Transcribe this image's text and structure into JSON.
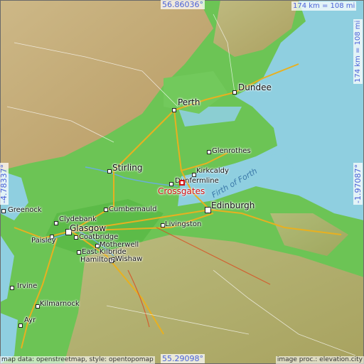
{
  "coords": {
    "north": "56.86036°",
    "south": "55.29098°",
    "west": "-4.78337°",
    "east": "-1.97087°",
    "scale_h": "174 km = 108 mi",
    "scale_v": "174 km = 108 mi"
  },
  "featured": {
    "name": "Crossgates"
  },
  "places": {
    "perth": "Perth",
    "dundee": "Dundee",
    "glenrothes": "Glenrothes",
    "kirkcaldy": "Kirkcaldy",
    "dunfermline": "Dunfermline",
    "stirling": "Stirling",
    "edinburgh": "Edinburgh",
    "cumbernauld": "Cumbernauld",
    "livingston": "Livingston",
    "greenock": "Greenock",
    "clydebank": "Clydebank",
    "glasgow": "Glasgow",
    "paisley": "Paisley",
    "coatbridge": "Coatbridge",
    "motherwell": "Motherwell",
    "east_kilbride": "East Kilbride",
    "hamilton": "Hamilton",
    "wishaw": "Wishaw",
    "irvine": "Irvine",
    "kilmarnock": "Kilmarnock",
    "ayr": "Ayr"
  },
  "water": {
    "firth_of_forth": "Firth of Forth"
  },
  "attribution": {
    "left": "map data: openstreetmap, style: opentopomap",
    "right": "image proc.: elevation.city"
  },
  "colors": {
    "sea": "#8fcfe0",
    "lowland": "#5fbf4a",
    "hills": "#c9b27a",
    "roads": "#e8b020",
    "featured": "#d01010",
    "coord_text": "#4a62d8"
  }
}
